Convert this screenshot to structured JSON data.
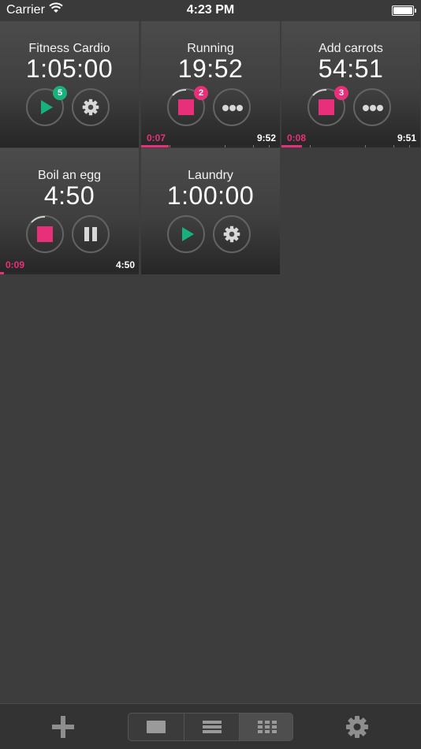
{
  "status": {
    "carrier": "Carrier",
    "time": "4:23 PM"
  },
  "colors": {
    "accent": "#e8307a",
    "play": "#17b27c",
    "tile_top": "#4b4b4b",
    "background": "#3d3d3d"
  },
  "timers": [
    {
      "name": "Fitness Cardio",
      "time": "1:05:00",
      "left_icon": "play-icon",
      "right_icon": "gear-icon",
      "badge": "5",
      "badge_color": "green",
      "elapsed": "",
      "total": ""
    },
    {
      "name": "Running",
      "time": "19:52",
      "left_icon": "stop-icon",
      "right_icon": "more-icon",
      "badge": "2",
      "badge_color": "pink",
      "elapsed": "0:07",
      "total": "9:52",
      "progress": 0.2
    },
    {
      "name": "Add carrots",
      "time": "54:51",
      "left_icon": "stop-icon",
      "right_icon": "more-icon",
      "badge": "3",
      "badge_color": "pink",
      "elapsed": "0:08",
      "total": "9:51",
      "progress": 0.15
    },
    {
      "name": "Boil an egg",
      "time": "4:50",
      "left_icon": "stop-icon",
      "right_icon": "pause-icon",
      "badge": "",
      "badge_color": "",
      "elapsed": "0:09",
      "total": "4:50",
      "progress": 0.03
    },
    {
      "name": "Laundry",
      "time": "1:00:00",
      "left_icon": "play-icon",
      "right_icon": "gear-icon",
      "badge": "",
      "badge_color": "",
      "elapsed": "",
      "total": ""
    }
  ],
  "tabbar": {
    "add_icon": "plus-icon",
    "views": [
      "single-view-icon",
      "list-view-icon",
      "grid-view-icon"
    ],
    "selected_view": "grid-view-icon",
    "settings_icon": "gear-icon"
  }
}
